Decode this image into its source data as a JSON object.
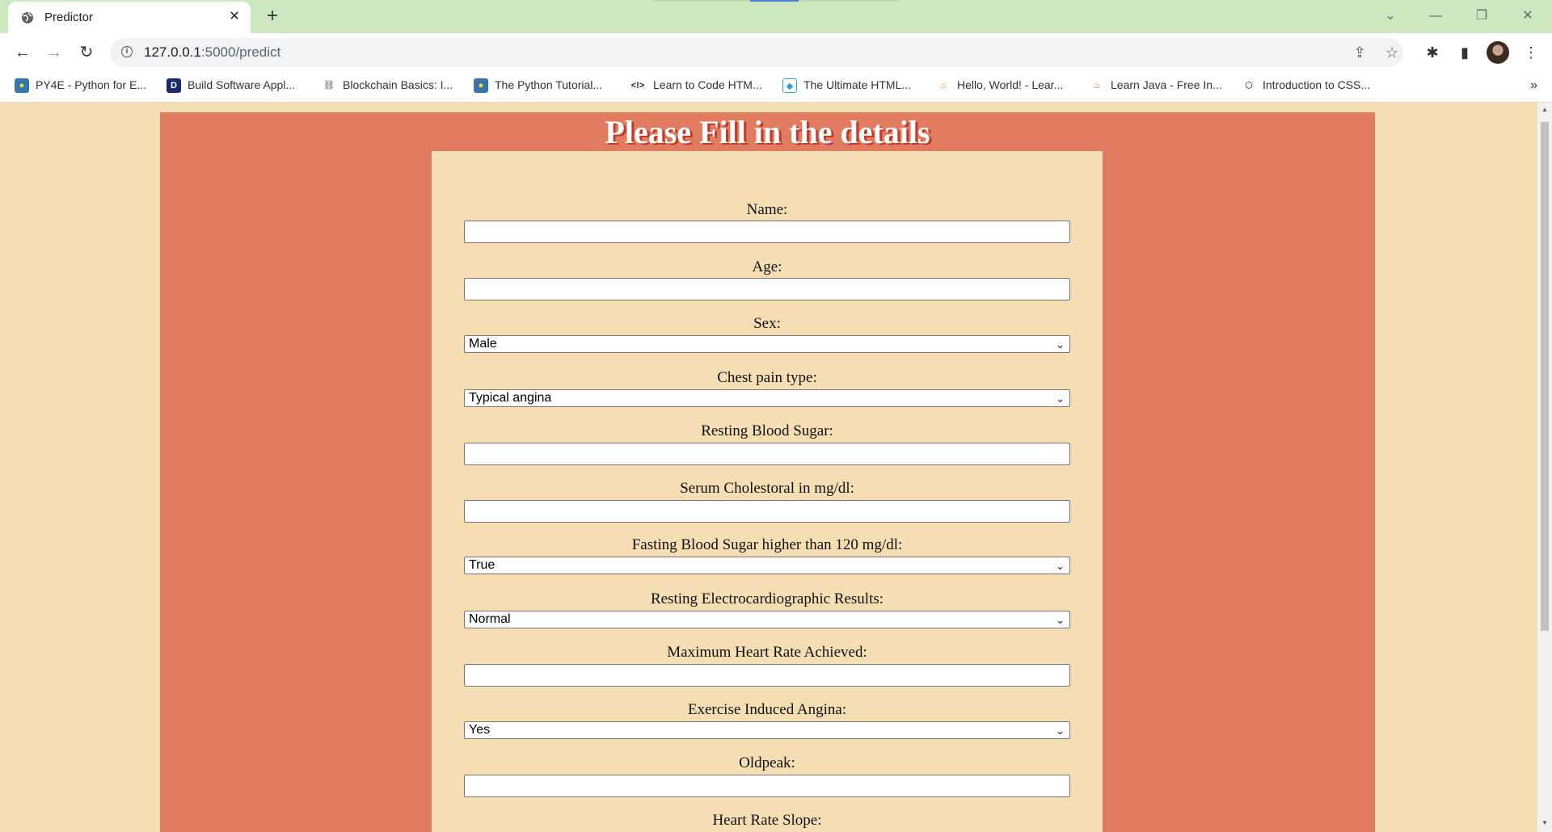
{
  "browser": {
    "tab_title": "Predictor",
    "url_host": "127.0.0.1",
    "url_rest": ":5000/predict",
    "bookmarks": [
      {
        "label": "PY4E - Python for E...",
        "icon": "python-icon"
      },
      {
        "label": "Build Software Appl...",
        "icon": "duke-icon"
      },
      {
        "label": "Blockchain Basics: I...",
        "icon": "blockchain-icon"
      },
      {
        "label": "The Python Tutorial...",
        "icon": "python-icon"
      },
      {
        "label": "Learn to Code HTM...",
        "icon": "code-icon"
      },
      {
        "label": "The Ultimate HTML...",
        "icon": "shield-icon"
      },
      {
        "label": "Hello, World! - Lear...",
        "icon": "java-icon"
      },
      {
        "label": "Learn Java - Free In...",
        "icon": "java-icon"
      },
      {
        "label": "Introduction to CSS...",
        "icon": "codepen-icon"
      }
    ]
  },
  "page": {
    "title": "Please Fill in the details",
    "fields": {
      "name": {
        "label": "Name:"
      },
      "age": {
        "label": "Age:"
      },
      "sex": {
        "label": "Sex:",
        "selected": "Male"
      },
      "chest_pain": {
        "label": "Chest pain type:",
        "selected": "Typical angina"
      },
      "resting_bs": {
        "label": "Resting Blood Sugar:"
      },
      "cholesterol": {
        "label": "Serum Cholestoral in mg/dl:"
      },
      "fasting_bs": {
        "label": "Fasting Blood Sugar higher than 120 mg/dl:",
        "selected": "True"
      },
      "rest_ecg": {
        "label": "Resting Electrocardiographic Results:",
        "selected": "Normal"
      },
      "max_hr": {
        "label": "Maximum Heart Rate Achieved:"
      },
      "exercise_angina": {
        "label": "Exercise Induced Angina:",
        "selected": "Yes"
      },
      "oldpeak": {
        "label": "Oldpeak:"
      },
      "slope": {
        "label": "Heart Rate Slope:"
      }
    }
  },
  "colors": {
    "panel": "#e27c60",
    "card": "#f5deb3",
    "tabstrip": "#cde8c0"
  }
}
